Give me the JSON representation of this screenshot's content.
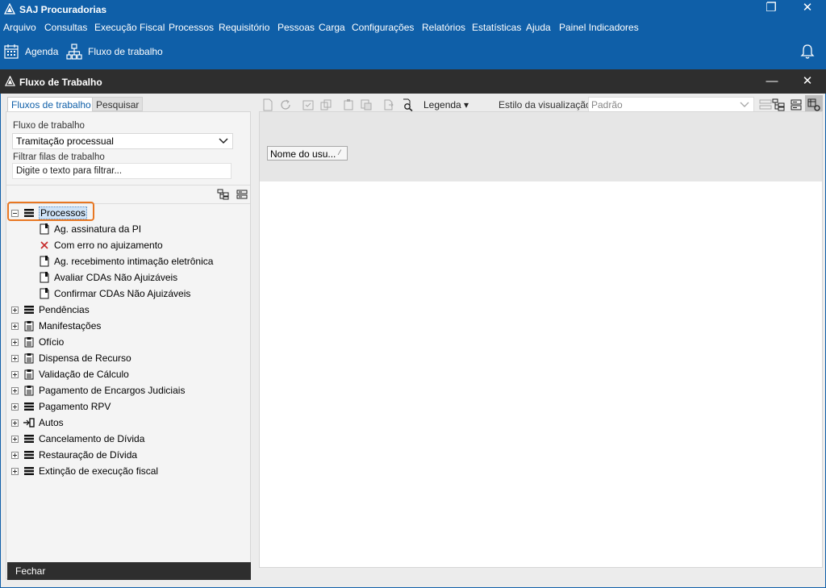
{
  "app": {
    "title": "SAJ Procuradorias",
    "window_controls": {
      "restore": "❐",
      "close": "✕"
    }
  },
  "menu": [
    "Arquivo",
    "Consultas",
    "Execução Fiscal",
    "Processos",
    "Requisitório",
    "Pessoas",
    "Carga",
    "Configurações",
    "Relatórios",
    "Estatísticas",
    "Ajuda",
    "Painel Indicadores"
  ],
  "toolbar": {
    "agenda": "Agenda",
    "fluxo": "Fluxo de trabalho"
  },
  "inner_window": {
    "title": "Fluxo de Trabalho",
    "minimize": "—",
    "close": "✕"
  },
  "left": {
    "tabs": [
      "Fluxos de trabalho",
      "Pesquisar"
    ],
    "fluxo_label": "Fluxo de trabalho",
    "fluxo_value": "Tramitação processual",
    "filtrar_label": "Filtrar filas de trabalho",
    "filtrar_placeholder": "Digite o texto para filtrar...",
    "tree": [
      {
        "label": "Processos",
        "expanded": true,
        "icon": "list-icon",
        "selected": true
      },
      {
        "label": "Ag. assinatura da PI",
        "child": true,
        "icon": "doc-icon"
      },
      {
        "label": "Com erro no ajuizamento",
        "child": true,
        "icon": "error-x-icon"
      },
      {
        "label": "Ag. recebimento intimação eletrônica",
        "child": true,
        "icon": "doc-icon"
      },
      {
        "label": "Avaliar CDAs Não Ajuizáveis",
        "child": true,
        "icon": "doc-icon"
      },
      {
        "label": "Confirmar CDAs Não Ajuizáveis",
        "child": true,
        "icon": "doc-icon"
      },
      {
        "label": "Pendências",
        "icon": "list-icon"
      },
      {
        "label": "Manifestações",
        "icon": "clipboard-icon"
      },
      {
        "label": "Ofício",
        "icon": "clipboard-icon"
      },
      {
        "label": "Dispensa de Recurso",
        "icon": "clipboard-icon"
      },
      {
        "label": "Validação de Cálculo",
        "icon": "clipboard-icon"
      },
      {
        "label": "Pagamento de Encargos Judiciais",
        "icon": "clipboard-icon"
      },
      {
        "label": "Pagamento RPV",
        "icon": "list-icon"
      },
      {
        "label": "Autos",
        "icon": "connector-icon"
      },
      {
        "label": "Cancelamento de Dívida",
        "icon": "list-icon"
      },
      {
        "label": "Restauração de Dívida",
        "icon": "list-icon"
      },
      {
        "label": "Extinção de execução fiscal",
        "icon": "list-icon"
      }
    ],
    "close_button": "Fechar"
  },
  "right": {
    "legenda": "Legenda",
    "estilo_label": "Estilo da visualização",
    "estilo_value": "Padrão",
    "column_header": "Nome do usu...",
    "sort_glyph": "⁄"
  },
  "colors": {
    "brand_blue": "#0f5fa8",
    "dark_bar": "#2e2e2e",
    "highlight_orange": "#e87722"
  }
}
